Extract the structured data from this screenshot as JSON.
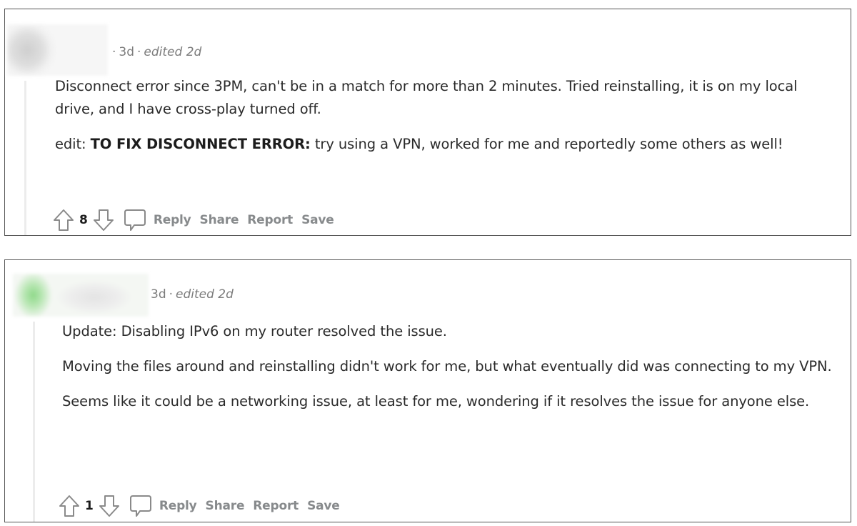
{
  "comments": [
    {
      "author_redacted": true,
      "meta": {
        "age": "3d",
        "edited": "edited 2d",
        "separator": "·"
      },
      "paragraphs": [
        {
          "text": "Disconnect error since 3PM, can't be in a match for more than 2 minutes. Tried reinstalling, it is on my local drive, and I have cross-play turned off."
        },
        {
          "prefix": "edit: ",
          "bold": "TO FIX DISCONNECT ERROR:",
          "text": " try using a VPN, worked for me and reportedly some others as well!"
        }
      ],
      "score": "8",
      "actions": {
        "upvote_icon": "upvote-arrow-icon",
        "downvote_icon": "downvote-arrow-icon",
        "comment_icon": "speech-bubble-icon",
        "reply": "Reply",
        "share": "Share",
        "report": "Report",
        "save": "Save"
      }
    },
    {
      "author_redacted": true,
      "meta": {
        "age": "3d",
        "edited": "edited 2d",
        "separator": "·"
      },
      "paragraphs": [
        {
          "text": "Update: Disabling IPv6 on my router resolved the issue."
        },
        {
          "text": "Moving the files around and reinstalling didn't work for me, but what eventually did was connecting to my VPN."
        },
        {
          "text": "Seems like it could be a networking issue, at least for me, wondering if it resolves the issue for anyone else."
        }
      ],
      "score": "1",
      "actions": {
        "upvote_icon": "upvote-arrow-icon",
        "downvote_icon": "downvote-arrow-icon",
        "comment_icon": "speech-bubble-icon",
        "reply": "Reply",
        "share": "Share",
        "report": "Report",
        "save": "Save"
      }
    }
  ],
  "colors": {
    "meta_text": "#7c7c7c",
    "action_text": "#878a8c",
    "body_text": "#2a2a2a",
    "card_border": "#555555",
    "thread_line": "#ececec",
    "avatar_accent_green": "#8fd98a"
  }
}
